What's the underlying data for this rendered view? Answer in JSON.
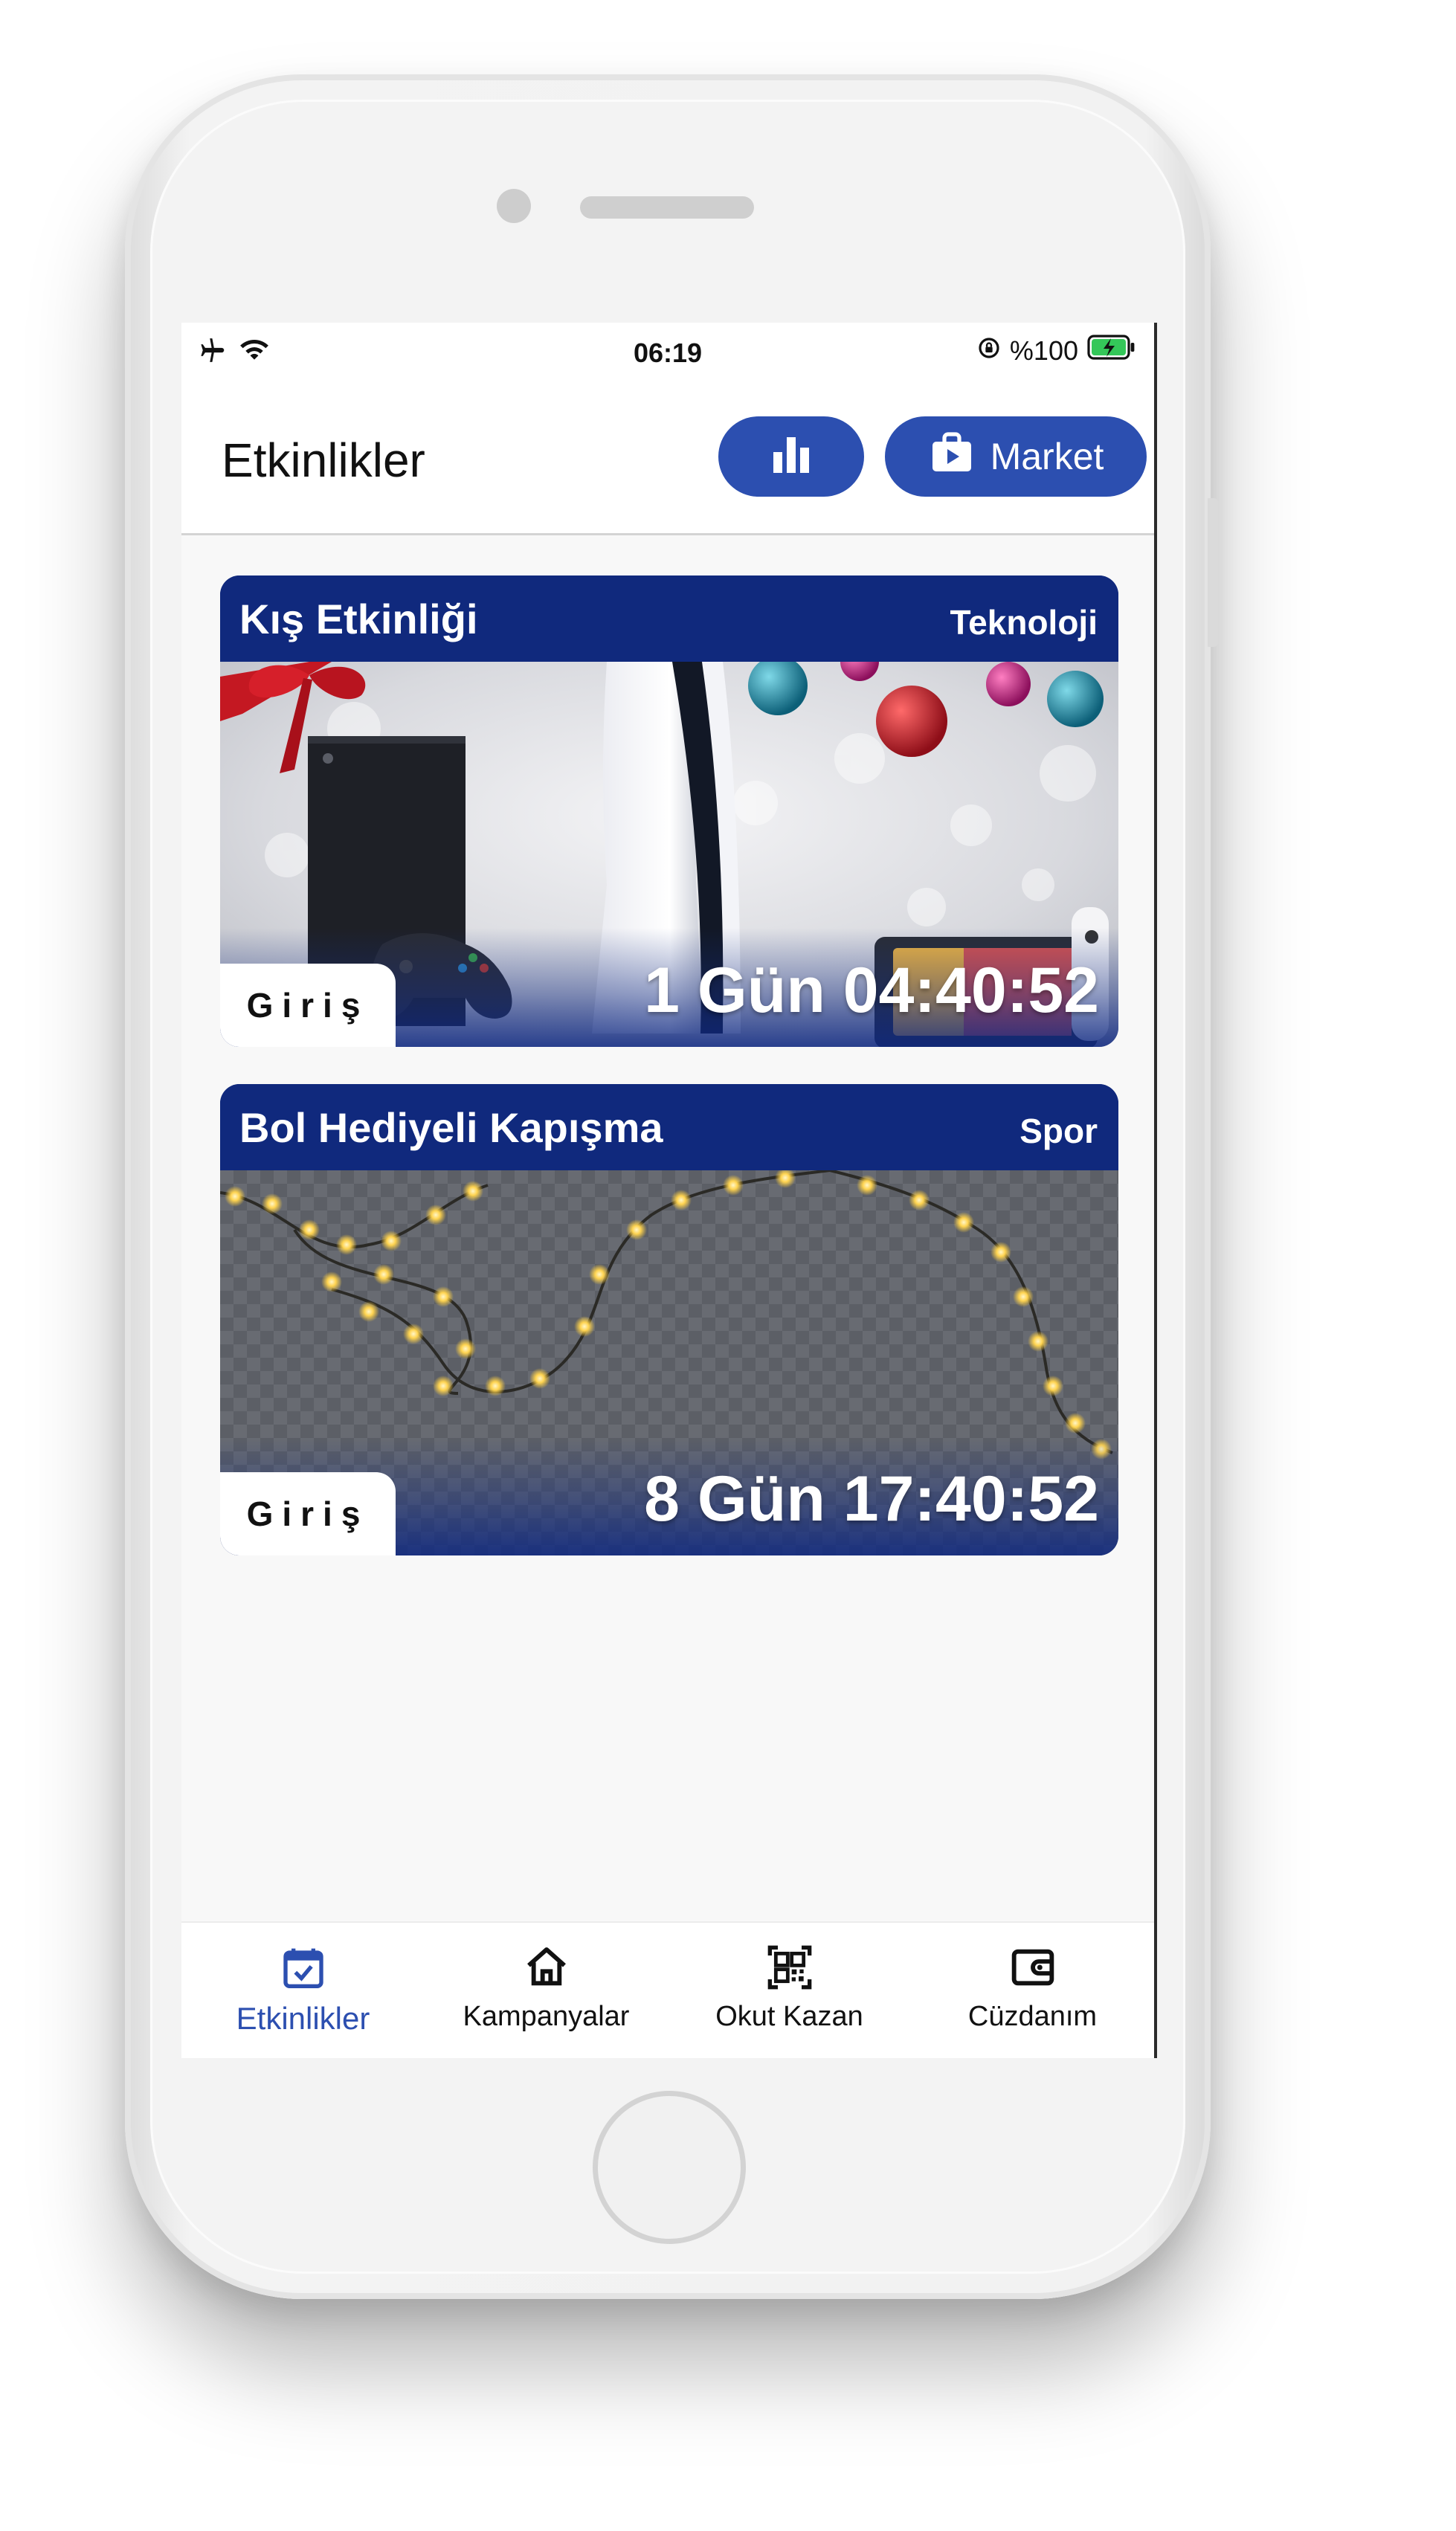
{
  "status_bar": {
    "time": "06:19",
    "battery_text": "%100",
    "left_icons": [
      "airplane-icon",
      "wifi-icon"
    ],
    "right_icons": [
      "rotation-lock-icon",
      "battery-charging-icon"
    ]
  },
  "header": {
    "title": "Etkinlikler",
    "stats_button_icon": "bar-chart-icon",
    "market_button_label": "Market",
    "market_button_icon": "shopping-bag-icon"
  },
  "events": [
    {
      "title": "Kış Etkinliği",
      "category": "Teknoloji",
      "enter_label": "Giriş",
      "countdown": "1 Gün 04:40:52",
      "image": "game-consoles-christmas-photo"
    },
    {
      "title": "Bol Hediyeli Kapışma",
      "category": "Spor",
      "enter_label": "Giriş",
      "countdown": "8 Gün 17:40:52",
      "image": "string-lights-photo"
    }
  ],
  "bottom_nav": {
    "items": [
      {
        "label": "Etkinlikler",
        "icon": "calendar-check-icon",
        "active": true
      },
      {
        "label": "Kampanyalar",
        "icon": "home-icon",
        "active": false
      },
      {
        "label": "Okut Kazan",
        "icon": "qr-code-icon",
        "active": false
      },
      {
        "label": "Cüzdanım",
        "icon": "wallet-icon",
        "active": false
      }
    ]
  },
  "colors": {
    "accent": "#2c4fb0",
    "card_header": "#10297d",
    "active_tab": "#2c4fb0"
  }
}
